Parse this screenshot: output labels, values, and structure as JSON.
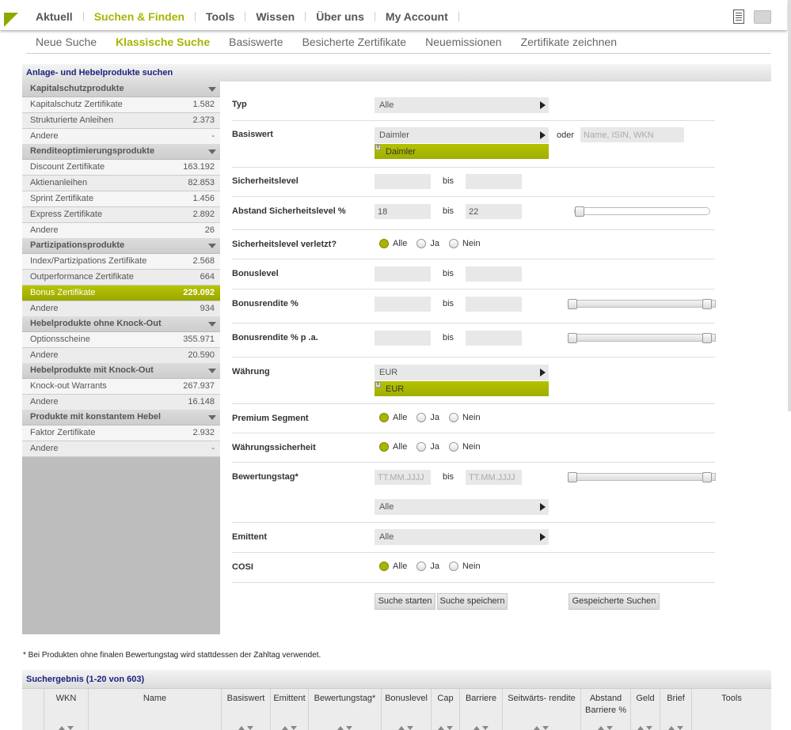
{
  "nav": {
    "main": [
      "Aktuell",
      "Suchen & Finden",
      "Tools",
      "Wissen",
      "Über uns",
      "My Account"
    ],
    "sub": [
      "Neue Suche",
      "Klassische Suche",
      "Basiswerte",
      "Besicherte Zertifikate",
      "Neuemissionen",
      "Zertifikate zeichnen"
    ],
    "tools": [
      "pdf-icon",
      "print-icon"
    ]
  },
  "panel": {
    "title": "Anlage- und Hebelprodukte suchen"
  },
  "sidebar": {
    "categories": [
      {
        "label": "Kapitalschutzprodukte",
        "items": [
          {
            "label": "Kapitalschutz Zertifikate",
            "count": "1.582"
          },
          {
            "label": "Strukturierte Anleihen",
            "count": "2.373"
          },
          {
            "label": "Andere",
            "count": "-"
          }
        ]
      },
      {
        "label": "Renditeoptimierungsprodukte",
        "items": [
          {
            "label": "Discount Zertifikate",
            "count": "163.192"
          },
          {
            "label": "Aktienanleihen",
            "count": "82.853"
          },
          {
            "label": "Sprint Zertifikate",
            "count": "1.456"
          },
          {
            "label": "Express Zertifikate",
            "count": "2.892"
          },
          {
            "label": "Andere",
            "count": "26"
          }
        ]
      },
      {
        "label": "Partizipationsprodukte",
        "items": [
          {
            "label": "Index/Partizipations Zertifikate",
            "count": "2.568"
          },
          {
            "label": "Outperformance Zertifikate",
            "count": "664"
          },
          {
            "label": "Bonus Zertifikate",
            "count": "229.092"
          },
          {
            "label": "Andere",
            "count": "934"
          }
        ]
      },
      {
        "label": "Hebelprodukte ohne Knock-Out",
        "items": [
          {
            "label": "Optionsscheine",
            "count": "355.971"
          },
          {
            "label": "Andere",
            "count": "20.590"
          }
        ]
      },
      {
        "label": "Hebelprodukte mit Knock-Out",
        "items": [
          {
            "label": "Knock-out Warrants",
            "count": "267.937"
          },
          {
            "label": "Andere",
            "count": "16.148"
          }
        ]
      },
      {
        "label": "Produkte mit konstantem Hebel",
        "items": [
          {
            "label": "Faktor Zertifikate",
            "count": "2.932"
          },
          {
            "label": "Andere",
            "count": "-"
          }
        ]
      }
    ]
  },
  "form": {
    "typ": {
      "label": "Typ",
      "value": "Alle"
    },
    "basiswert": {
      "label": "Basiswert",
      "value": "Daimler",
      "chip": "Daimler",
      "oder": "oder",
      "search_placeholder": "Name, ISIN, WKN"
    },
    "sicherheitslevel": {
      "label": "Sicherheitslevel",
      "bis": "bis",
      "from": "",
      "to": ""
    },
    "abstand": {
      "label": "Abstand Sicherheitslevel %",
      "bis": "bis",
      "from": "18",
      "to": "22"
    },
    "verletzt": {
      "label": "Sicherheitslevel verletzt?",
      "options": [
        "Alle",
        "Ja",
        "Nein"
      ]
    },
    "bonuslevel": {
      "label": "Bonuslevel",
      "bis": "bis",
      "from": "",
      "to": ""
    },
    "bonusrendite": {
      "label": "Bonusrendite %",
      "bis": "bis",
      "from": "",
      "to": ""
    },
    "bonusrendite_pa": {
      "label": "Bonusrendite % p .a.",
      "bis": "bis",
      "from": "",
      "to": ""
    },
    "waehrung": {
      "label": "Währung",
      "value": "EUR",
      "chip": "EUR"
    },
    "premium": {
      "label": "Premium Segment",
      "options": [
        "Alle",
        "Ja",
        "Nein"
      ]
    },
    "waehrungssicherheit": {
      "label": "Währungssicherheit",
      "options": [
        "Alle",
        "Ja",
        "Nein"
      ]
    },
    "bewertungstag": {
      "label": "Bewertungstag*",
      "bis": "bis",
      "from_placeholder": "TT.MM.JJJJ",
      "to_placeholder": "TT.MM.JJJJ",
      "period": "Alle"
    },
    "emittent": {
      "label": "Emittent",
      "value": "Alle"
    },
    "cosi": {
      "label": "COSI",
      "options": [
        "Alle",
        "Ja",
        "Nein"
      ]
    },
    "buttons": {
      "start": "Suche starten",
      "save": "Suche speichern",
      "saved": "Gespeicherte Suchen"
    }
  },
  "footnote": "* Bei Produkten ohne finalen Bewertungstag wird stattdessen der Zahltag verwendet.",
  "results": {
    "title": "Suchergebnis (1-20 von 603)",
    "columns": [
      "WKN",
      "Name",
      "Basiswert",
      "Emittent",
      "Bewertungstag*",
      "Bonuslevel",
      "Cap",
      "Barriere",
      "Seitwärts- rendite",
      "Abstand Barriere %",
      "Geld",
      "Brief",
      "Tools"
    ]
  },
  "colors": {
    "accent": "#a8b400",
    "title": "#1a237e"
  }
}
